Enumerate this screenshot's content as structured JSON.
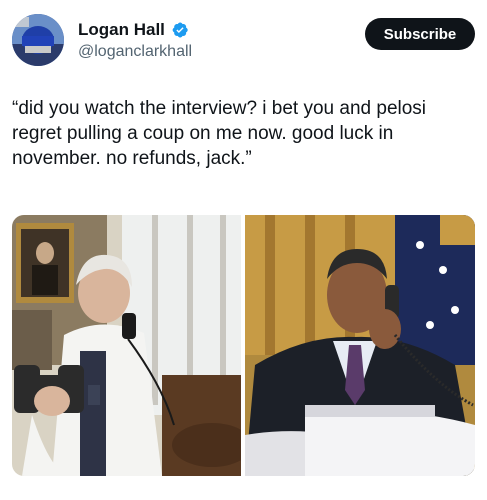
{
  "author": {
    "name": "Logan Hall",
    "handle": "@loganclarkhall",
    "avatar_icon": "avatar-hat-photo",
    "verified_icon": "verified-badge-icon",
    "verified_color": "#1d9bf0"
  },
  "subscribe_label": "Subscribe",
  "tweet": {
    "text": "“did you watch the interview? i bet you and pelosi regret pulling a coup on me now. good luck in november. no refunds, jack.”"
  },
  "media": {
    "images": [
      {
        "name": "photo-man-with-dumbbell-on-phone"
      },
      {
        "name": "photo-man-in-suit-on-phone"
      }
    ]
  }
}
